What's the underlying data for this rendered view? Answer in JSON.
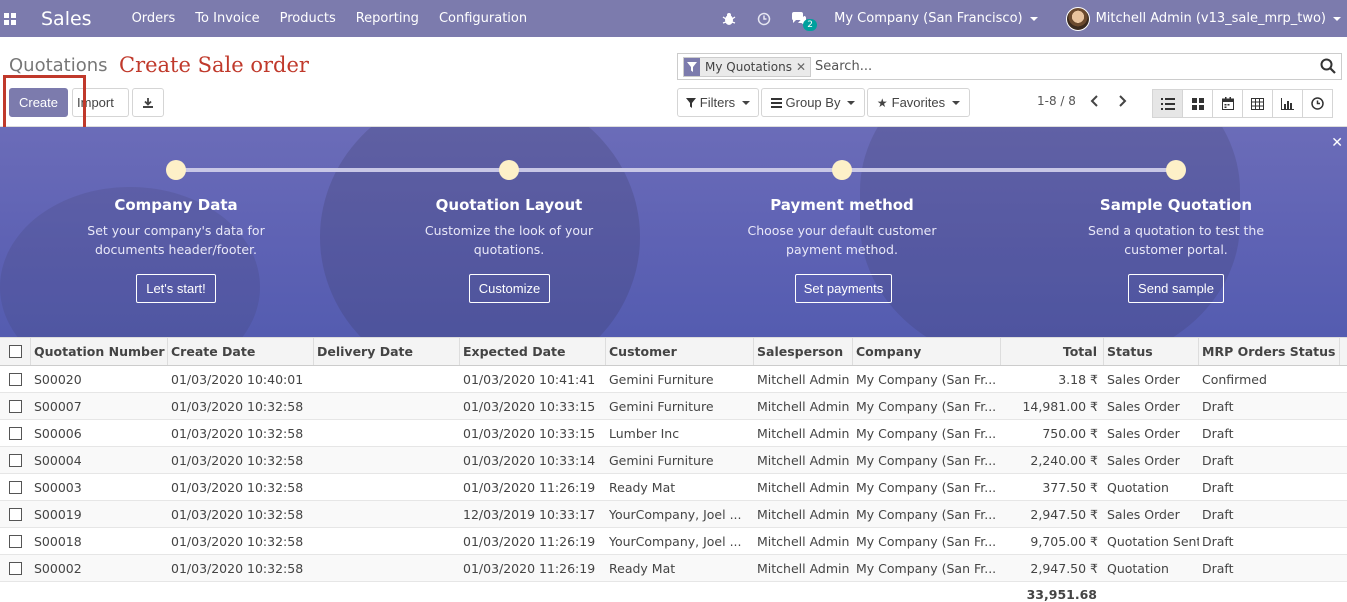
{
  "topbar": {
    "app_title": "Sales",
    "menu": [
      "Orders",
      "To Invoice",
      "Products",
      "Reporting",
      "Configuration"
    ],
    "chat_count": "2",
    "company": "My Company (San Francisco)",
    "user": "Mitchell Admin (v13_sale_mrp_two)"
  },
  "control_panel": {
    "breadcrumb": "Quotations",
    "annotation": "Create Sale order",
    "create_label": "Create",
    "import_label": "Import",
    "search": {
      "facet": "My Quotations",
      "placeholder": "Search..."
    },
    "filters_label": "Filters",
    "groupby_label": "Group By",
    "favorites_label": "Favorites",
    "pager": "1-8 / 8"
  },
  "banner": {
    "steps": [
      {
        "title": "Company Data",
        "desc1": "Set your company's data for",
        "desc2": "documents header/footer.",
        "button": "Let's start!"
      },
      {
        "title": "Quotation Layout",
        "desc1": "Customize the look of your",
        "desc2": "quotations.",
        "button": "Customize"
      },
      {
        "title": "Payment method",
        "desc1": "Choose your default customer",
        "desc2": "payment method.",
        "button": "Set payments"
      },
      {
        "title": "Sample Quotation",
        "desc1": "Send a quotation to test the",
        "desc2": "customer portal.",
        "button": "Send sample"
      }
    ]
  },
  "table": {
    "columns": [
      "Quotation Number",
      "Create Date",
      "Delivery Date",
      "Expected Date",
      "Customer",
      "Salesperson",
      "Company",
      "Total",
      "Status",
      "MRP Orders Status"
    ],
    "rows": [
      {
        "number": "S00020",
        "create": "01/03/2020 10:40:01",
        "delivery": "",
        "expected": "01/03/2020 10:41:41",
        "customer": "Gemini Furniture",
        "salesperson": "Mitchell Admin",
        "company": "My Company (San Fr...",
        "total": "3.18 ₹",
        "status": "Sales Order",
        "mrp": "Confirmed"
      },
      {
        "number": "S00007",
        "create": "01/03/2020 10:32:58",
        "delivery": "",
        "expected": "01/03/2020 10:33:15",
        "customer": "Gemini Furniture",
        "salesperson": "Mitchell Admin",
        "company": "My Company (San Fr...",
        "total": "14,981.00 ₹",
        "status": "Sales Order",
        "mrp": "Draft"
      },
      {
        "number": "S00006",
        "create": "01/03/2020 10:32:58",
        "delivery": "",
        "expected": "01/03/2020 10:33:15",
        "customer": "Lumber Inc",
        "salesperson": "Mitchell Admin",
        "company": "My Company (San Fr...",
        "total": "750.00 ₹",
        "status": "Sales Order",
        "mrp": "Draft"
      },
      {
        "number": "S00004",
        "create": "01/03/2020 10:32:58",
        "delivery": "",
        "expected": "01/03/2020 10:33:14",
        "customer": "Gemini Furniture",
        "salesperson": "Mitchell Admin",
        "company": "My Company (San Fr...",
        "total": "2,240.00 ₹",
        "status": "Sales Order",
        "mrp": "Draft"
      },
      {
        "number": "S00003",
        "create": "01/03/2020 10:32:58",
        "delivery": "",
        "expected": "01/03/2020 11:26:19",
        "customer": "Ready Mat",
        "salesperson": "Mitchell Admin",
        "company": "My Company (San Fr...",
        "total": "377.50 ₹",
        "status": "Quotation",
        "mrp": "Draft"
      },
      {
        "number": "S00019",
        "create": "01/03/2020 10:32:58",
        "delivery": "",
        "expected": "12/03/2019 10:33:17",
        "customer": "YourCompany, Joel ...",
        "salesperson": "Mitchell Admin",
        "company": "My Company (San Fr...",
        "total": "2,947.50 ₹",
        "status": "Sales Order",
        "mrp": "Draft"
      },
      {
        "number": "S00018",
        "create": "01/03/2020 10:32:58",
        "delivery": "",
        "expected": "01/03/2020 11:26:19",
        "customer": "YourCompany, Joel ...",
        "salesperson": "Mitchell Admin",
        "company": "My Company (San Fr...",
        "total": "9,705.00 ₹",
        "status": "Quotation Sent",
        "mrp": "Draft"
      },
      {
        "number": "S00002",
        "create": "01/03/2020 10:32:58",
        "delivery": "",
        "expected": "01/03/2020 11:26:19",
        "customer": "Ready Mat",
        "salesperson": "Mitchell Admin",
        "company": "My Company (San Fr...",
        "total": "2,947.50 ₹",
        "status": "Quotation",
        "mrp": "Draft"
      }
    ],
    "grand_total": "33,951.68"
  },
  "colors": {
    "brand": "#7c7bad",
    "annotation": "#c0392b",
    "banner": "#5e62b4"
  }
}
